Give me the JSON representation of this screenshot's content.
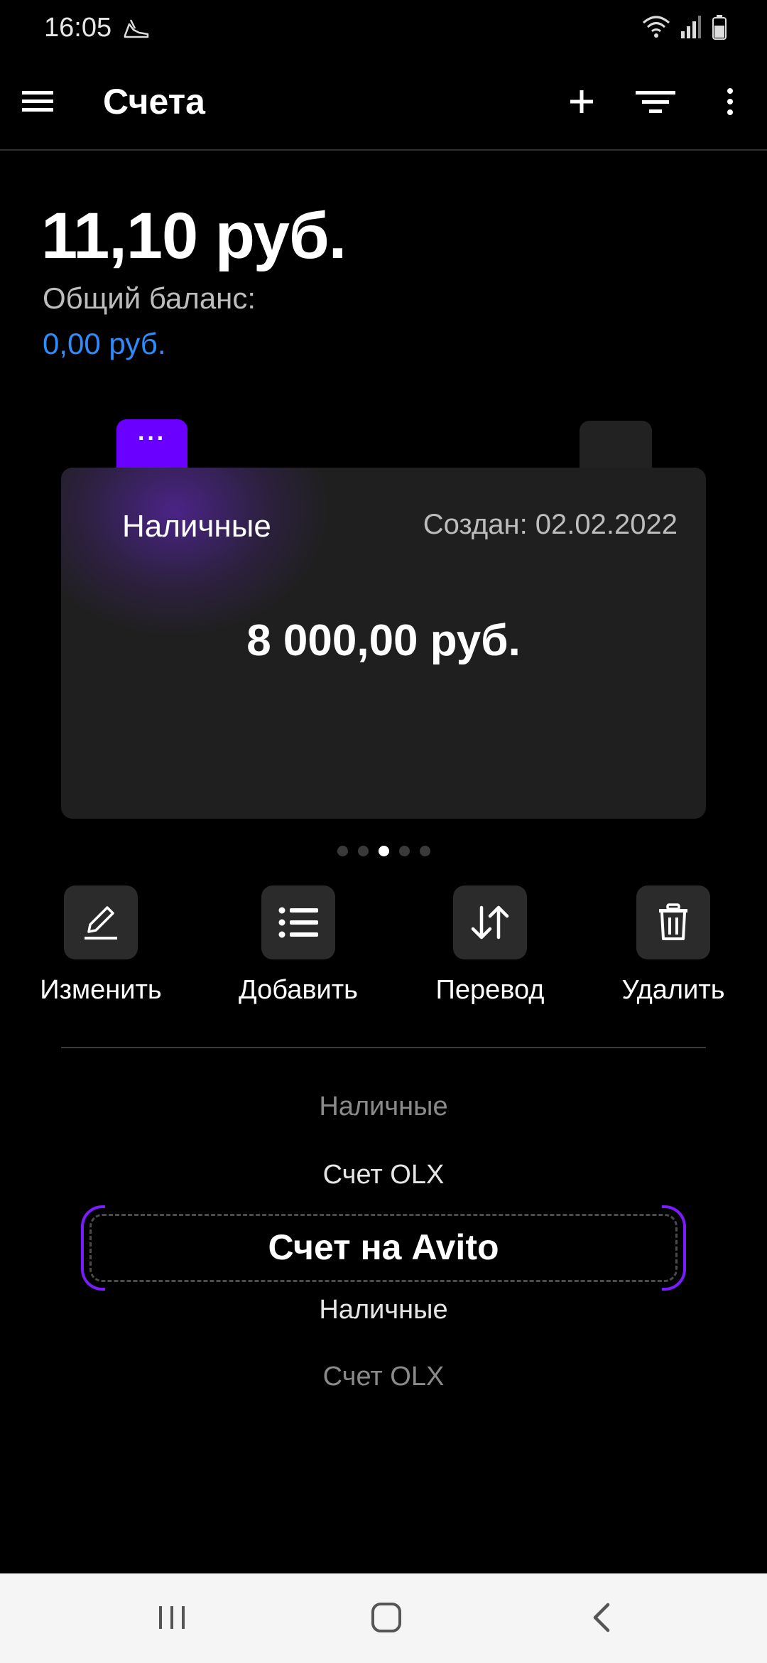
{
  "status_bar": {
    "time": "16:05",
    "app_icon": "sneaker-icon",
    "right_icons": [
      "wifi-icon",
      "signal-icon",
      "battery-icon"
    ]
  },
  "app_bar": {
    "title": "Счета",
    "icons": [
      "menu-icon",
      "plus-icon",
      "filter-icon",
      "more-vert-icon"
    ]
  },
  "balance": {
    "amount": "11,10 руб.",
    "label": "Общий баланс:",
    "total": "0,00 руб."
  },
  "card": {
    "tab_label": "···",
    "name": "Наличные",
    "created": "Создан: 02.02.2022",
    "amount": "8 000,00 руб."
  },
  "pager": {
    "count": 5,
    "active_index": 2
  },
  "actions": [
    {
      "label": "Изменить",
      "icon": "pencil-icon"
    },
    {
      "label": "Добавить",
      "icon": "list-icon"
    },
    {
      "label": "Перевод",
      "icon": "transfer-icon"
    },
    {
      "label": "Удалить",
      "icon": "trash-icon"
    }
  ],
  "picker": {
    "items": [
      "Наличные",
      "Счет OLX",
      "Счет на Avito",
      "Наличные",
      "Счет OLX"
    ],
    "selected_index": 2
  },
  "colors": {
    "accent": "#6a00ff",
    "link": "#2f8cff",
    "background": "#000000",
    "card": "#1f1f1f"
  },
  "nav_bar": {
    "icons": [
      "recent-apps-icon",
      "home-icon",
      "back-icon"
    ]
  }
}
